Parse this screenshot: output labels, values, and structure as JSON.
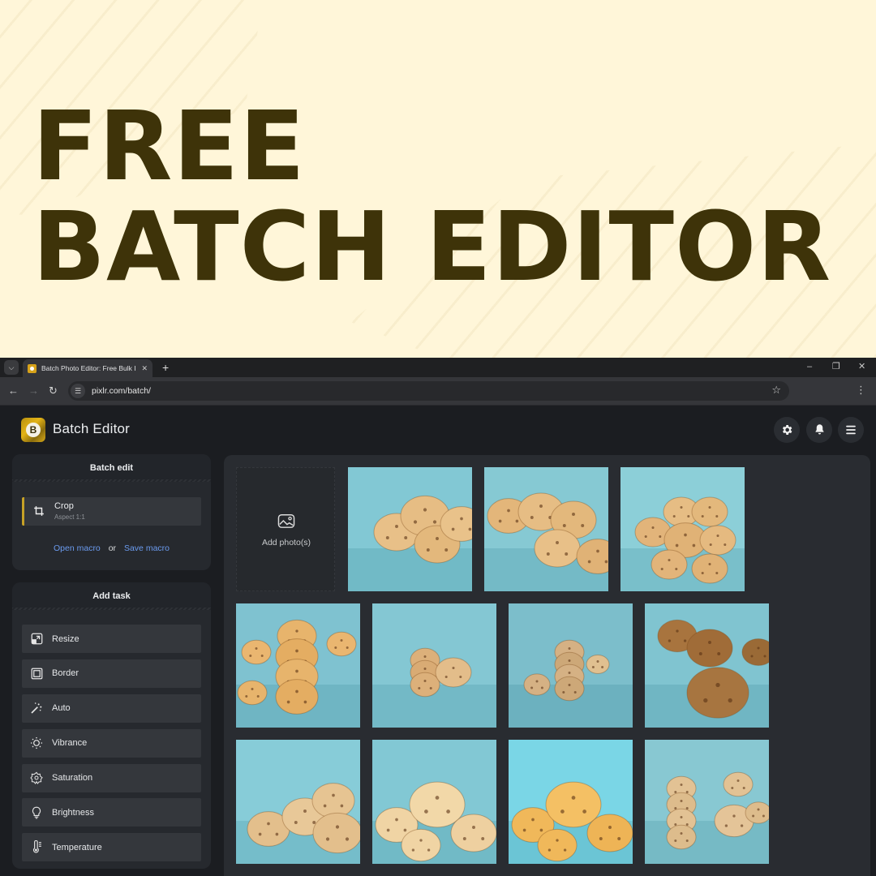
{
  "banner": {
    "line1": "FREE",
    "line2": "BATCH EDITOR",
    "background_color": "#fff6d9",
    "text_color": "#3e3309"
  },
  "browser": {
    "tab_list_icon": "chevron-down-icon",
    "tab": {
      "title": "Batch Photo Editor: Free Bulk In",
      "close": "✕"
    },
    "new_tab": "+",
    "window_controls": {
      "minimize": "–",
      "restore": "❐",
      "close": "✕"
    },
    "nav": {
      "back": "←",
      "forward": "→",
      "reload": "↻"
    },
    "url": "pixlr.com/batch/",
    "bookmark_icon": "☆",
    "menu_icon": "⋮"
  },
  "app": {
    "title": "Batch Editor",
    "logo_letter": "B",
    "accent_color": "#c6a126",
    "link_color": "#6b9bef",
    "header_buttons": [
      {
        "name": "settings",
        "glyph": "⚙"
      },
      {
        "name": "notifications",
        "glyph": "🔔"
      },
      {
        "name": "menu",
        "glyph": "☰"
      }
    ]
  },
  "batch_edit": {
    "heading": "Batch edit",
    "steps": [
      {
        "name": "Crop",
        "detail": "Aspect 1:1"
      }
    ],
    "open_macro": "Open macro",
    "or": "or",
    "save_macro": "Save macro"
  },
  "add_task": {
    "heading": "Add task",
    "items": [
      {
        "label": "Resize",
        "icon": "resize-icon"
      },
      {
        "label": "Border",
        "icon": "border-icon"
      },
      {
        "label": "Auto",
        "icon": "magic-wand-icon"
      },
      {
        "label": "Vibrance",
        "icon": "sun-icon"
      },
      {
        "label": "Saturation",
        "icon": "saturation-icon"
      },
      {
        "label": "Brightness",
        "icon": "lightbulb-icon"
      },
      {
        "label": "Temperature",
        "icon": "thermometer-icon"
      }
    ]
  },
  "photos": {
    "add_label": "Add photo(s)",
    "items": [
      {
        "desc": "Stack of white chip cookies on blue"
      },
      {
        "desc": "Pile of chunky cookies on blue"
      },
      {
        "desc": "Heap of round cookies on blue"
      },
      {
        "desc": "Tall stack of scalloped butter cookies"
      },
      {
        "desc": "Small stack of cookies with crumbs"
      },
      {
        "desc": "Biscuit stack with bitten cookie"
      },
      {
        "desc": "Large chocolate chip cookies"
      },
      {
        "desc": "Chocolate chip cookies pile"
      },
      {
        "desc": "Soft sugar cookies pile"
      },
      {
        "desc": "Golden soft cookies pile"
      },
      {
        "desc": "Stacks of oat cookies"
      }
    ]
  }
}
